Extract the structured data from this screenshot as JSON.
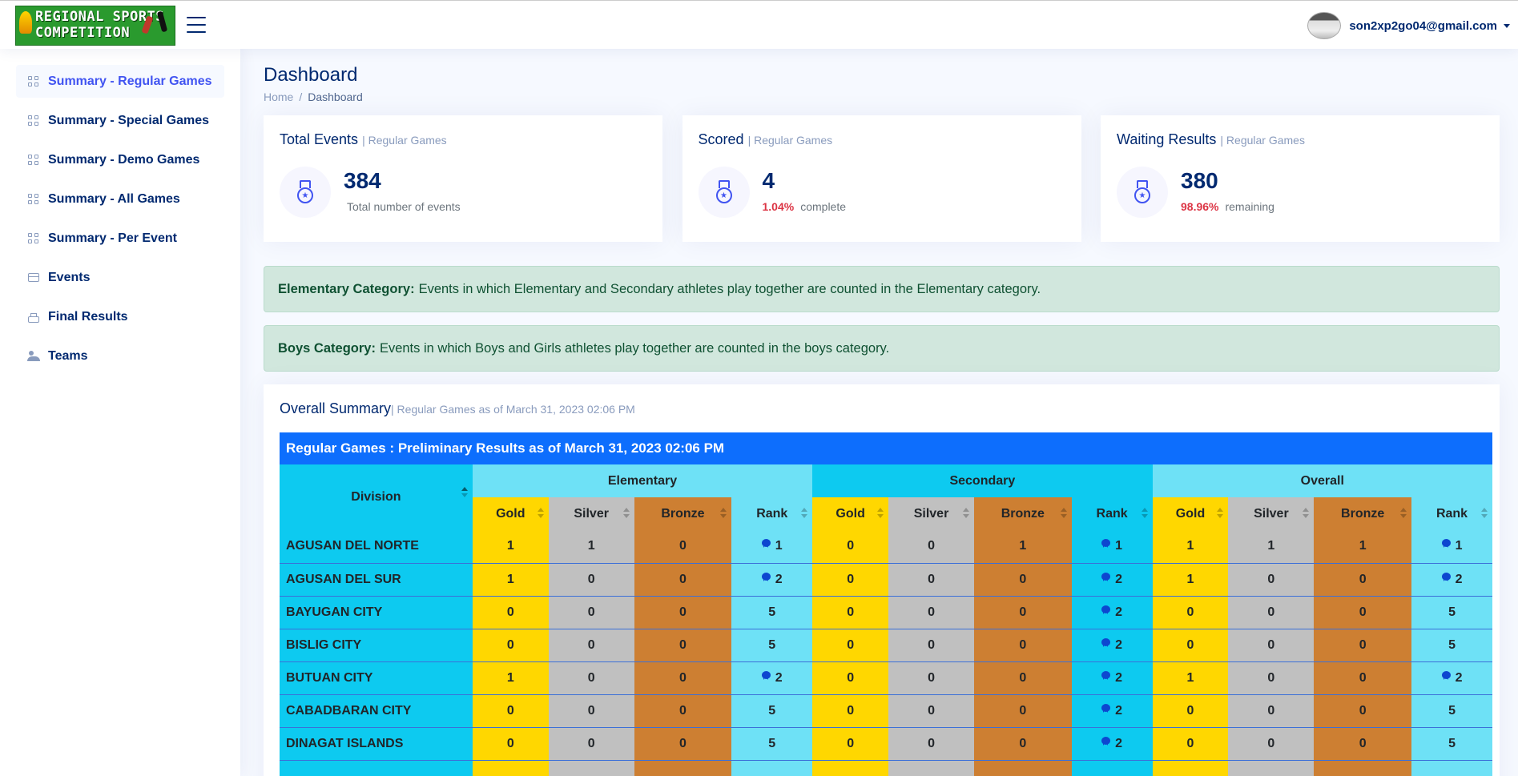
{
  "header": {
    "logo_line1": "REGIONAL SPORTS",
    "logo_line2": "COMPETITION",
    "user_email": "son2xp2go04@gmail.com"
  },
  "sidebar": {
    "items": [
      {
        "label": "Summary - Regular Games",
        "icon": "grid-icon",
        "active": true
      },
      {
        "label": "Summary - Special Games",
        "icon": "grid-icon"
      },
      {
        "label": "Summary - Demo Games",
        "icon": "grid-icon"
      },
      {
        "label": "Summary - All Games",
        "icon": "grid-icon"
      },
      {
        "label": "Summary - Per Event",
        "icon": "grid-icon"
      },
      {
        "label": "Events",
        "icon": "card-icon"
      },
      {
        "label": "Final Results",
        "icon": "printer-icon"
      },
      {
        "label": "Teams",
        "icon": "people-icon"
      }
    ]
  },
  "page": {
    "title": "Dashboard",
    "breadcrumb": [
      "Home",
      "Dashboard"
    ]
  },
  "cards": [
    {
      "title": "Total Events",
      "sub": "| Regular Games",
      "value": "384",
      "pct": "",
      "desc": "Total number of events",
      "icon": "medal-icon"
    },
    {
      "title": "Scored",
      "sub": "| Regular Games",
      "value": "4",
      "pct": "1.04%",
      "desc": "complete",
      "icon": "medal-icon"
    },
    {
      "title": "Waiting Results",
      "sub": "| Regular Games",
      "value": "380",
      "pct": "98.96%",
      "desc": "remaining",
      "icon": "medal-icon"
    }
  ],
  "alerts": [
    {
      "bold": "Elementary Category:",
      "text": "Events in which Elementary and Secondary athletes play together are counted in the Elementary category."
    },
    {
      "bold": "Boys Category:",
      "text": "Events in which Boys and Girls athletes play together are counted in the boys category."
    }
  ],
  "summary": {
    "title": "Overall Summary",
    "sub": "| Regular Games as of March 31, 2023 02:06 PM",
    "caption": "Regular Games : Preliminary Results as of March 31, 2023 02:06 PM",
    "division_header": "Division",
    "groups": [
      "Elementary",
      "Secondary",
      "Overall"
    ],
    "columns": [
      "Gold",
      "Silver",
      "Bronze",
      "Rank"
    ],
    "colors": {
      "gold": "#ffd700",
      "silver": "#c0c0c0",
      "bronze": "#cd7f32",
      "rank": "#6ee1f6",
      "caption": "#0d6efd"
    },
    "rows": [
      {
        "division": "AGUSAN DEL NORTE",
        "cells": [
          "1",
          "1",
          "0",
          "1",
          "0",
          "0",
          "1",
          "1",
          "1",
          "1",
          "1",
          "1"
        ],
        "award": [
          true,
          true,
          true
        ]
      },
      {
        "division": "AGUSAN DEL SUR",
        "cells": [
          "1",
          "0",
          "0",
          "2",
          "0",
          "0",
          "0",
          "2",
          "1",
          "0",
          "0",
          "2"
        ],
        "award": [
          true,
          true,
          true
        ]
      },
      {
        "division": "BAYUGAN CITY",
        "cells": [
          "0",
          "0",
          "0",
          "5",
          "0",
          "0",
          "0",
          "2",
          "0",
          "0",
          "0",
          "5"
        ],
        "award": [
          false,
          true,
          false
        ]
      },
      {
        "division": "BISLIG CITY",
        "cells": [
          "0",
          "0",
          "0",
          "5",
          "0",
          "0",
          "0",
          "2",
          "0",
          "0",
          "0",
          "5"
        ],
        "award": [
          false,
          true,
          false
        ]
      },
      {
        "division": "BUTUAN CITY",
        "cells": [
          "1",
          "0",
          "0",
          "2",
          "0",
          "0",
          "0",
          "2",
          "1",
          "0",
          "0",
          "2"
        ],
        "award": [
          true,
          true,
          true
        ]
      },
      {
        "division": "CABADBARAN CITY",
        "cells": [
          "0",
          "0",
          "0",
          "5",
          "0",
          "0",
          "0",
          "2",
          "0",
          "0",
          "0",
          "5"
        ],
        "award": [
          false,
          true,
          false
        ]
      },
      {
        "division": "DINAGAT ISLANDS",
        "cells": [
          "0",
          "0",
          "0",
          "5",
          "0",
          "0",
          "0",
          "2",
          "0",
          "0",
          "0",
          "5"
        ],
        "award": [
          false,
          true,
          false
        ]
      },
      {
        "division": "",
        "cells": [
          "",
          "",
          "",
          "",
          "",
          "",
          "",
          "",
          "",
          "",
          "",
          ""
        ],
        "award": [
          false,
          false,
          false
        ]
      }
    ]
  }
}
